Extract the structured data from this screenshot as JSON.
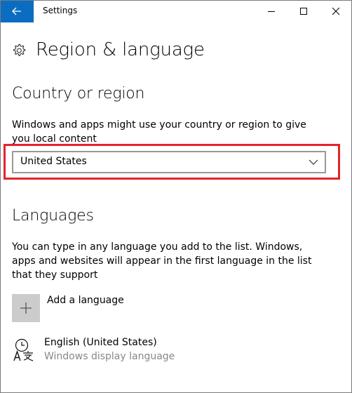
{
  "window": {
    "title": "Settings",
    "accent": "#0a6dc2"
  },
  "header": {
    "title": "Region & language"
  },
  "country_section": {
    "title": "Country or region",
    "description": "Windows and apps might use your country or region to give you local content",
    "selected_country": "United States",
    "highlight_color": "#e3232b"
  },
  "languages_section": {
    "title": "Languages",
    "description": "You can type in any language you add to the list. Windows, apps and websites will appear in the first language in the list that they support",
    "add_label": "Add a language",
    "items": [
      {
        "name": "English (United States)",
        "subtitle": "Windows display language"
      }
    ]
  }
}
